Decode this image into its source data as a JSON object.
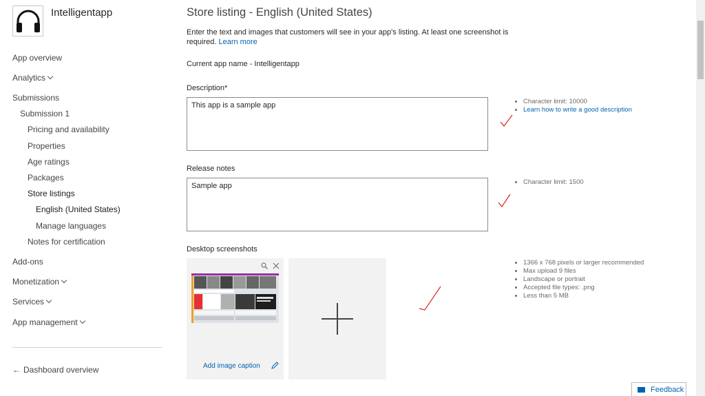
{
  "app": {
    "name": "Intelligentapp",
    "icon": "headphones-icon"
  },
  "sidebar": {
    "items": [
      {
        "label": "App overview"
      },
      {
        "label": "Analytics"
      },
      {
        "label": "Submissions"
      },
      {
        "label": "Submission 1"
      },
      {
        "label": "Pricing and availability"
      },
      {
        "label": "Properties"
      },
      {
        "label": "Age ratings"
      },
      {
        "label": "Packages"
      },
      {
        "label": "Store listings"
      },
      {
        "label": "English (United States)"
      },
      {
        "label": "Manage languages"
      },
      {
        "label": "Notes for certification"
      },
      {
        "label": "Add-ons"
      },
      {
        "label": "Monetization"
      },
      {
        "label": "Services"
      },
      {
        "label": "App management"
      }
    ],
    "dashboard_link": "Dashboard overview"
  },
  "main": {
    "title": "Store listing - English (United States)",
    "intro": "Enter the text and images that customers will see in your app's listing. At least one screenshot is required.",
    "learn_more": "Learn more",
    "current_app_name": "Current app name - Intelligentapp",
    "description": {
      "label": "Description*",
      "value": "This app is a sample app",
      "hints": [
        "Character limit: 10000"
      ],
      "hint_link": "Learn how to write a good description"
    },
    "release_notes": {
      "label": "Release notes",
      "value": "Sample app",
      "hints": [
        "Character limit: 1500"
      ]
    },
    "screenshots": {
      "label": "Desktop screenshots",
      "caption_button": "Add image caption",
      "hints": [
        "1366 x 768 pixels or larger recommended",
        "Max upload 9 files",
        "Landscape or portrait",
        "Accepted file types: .png",
        "Less than 5 MB"
      ]
    }
  },
  "feedback": {
    "label": "Feedback"
  },
  "colors": {
    "link": "#0063b1",
    "annotation": "#e02020",
    "card": "#f2f2f2"
  }
}
